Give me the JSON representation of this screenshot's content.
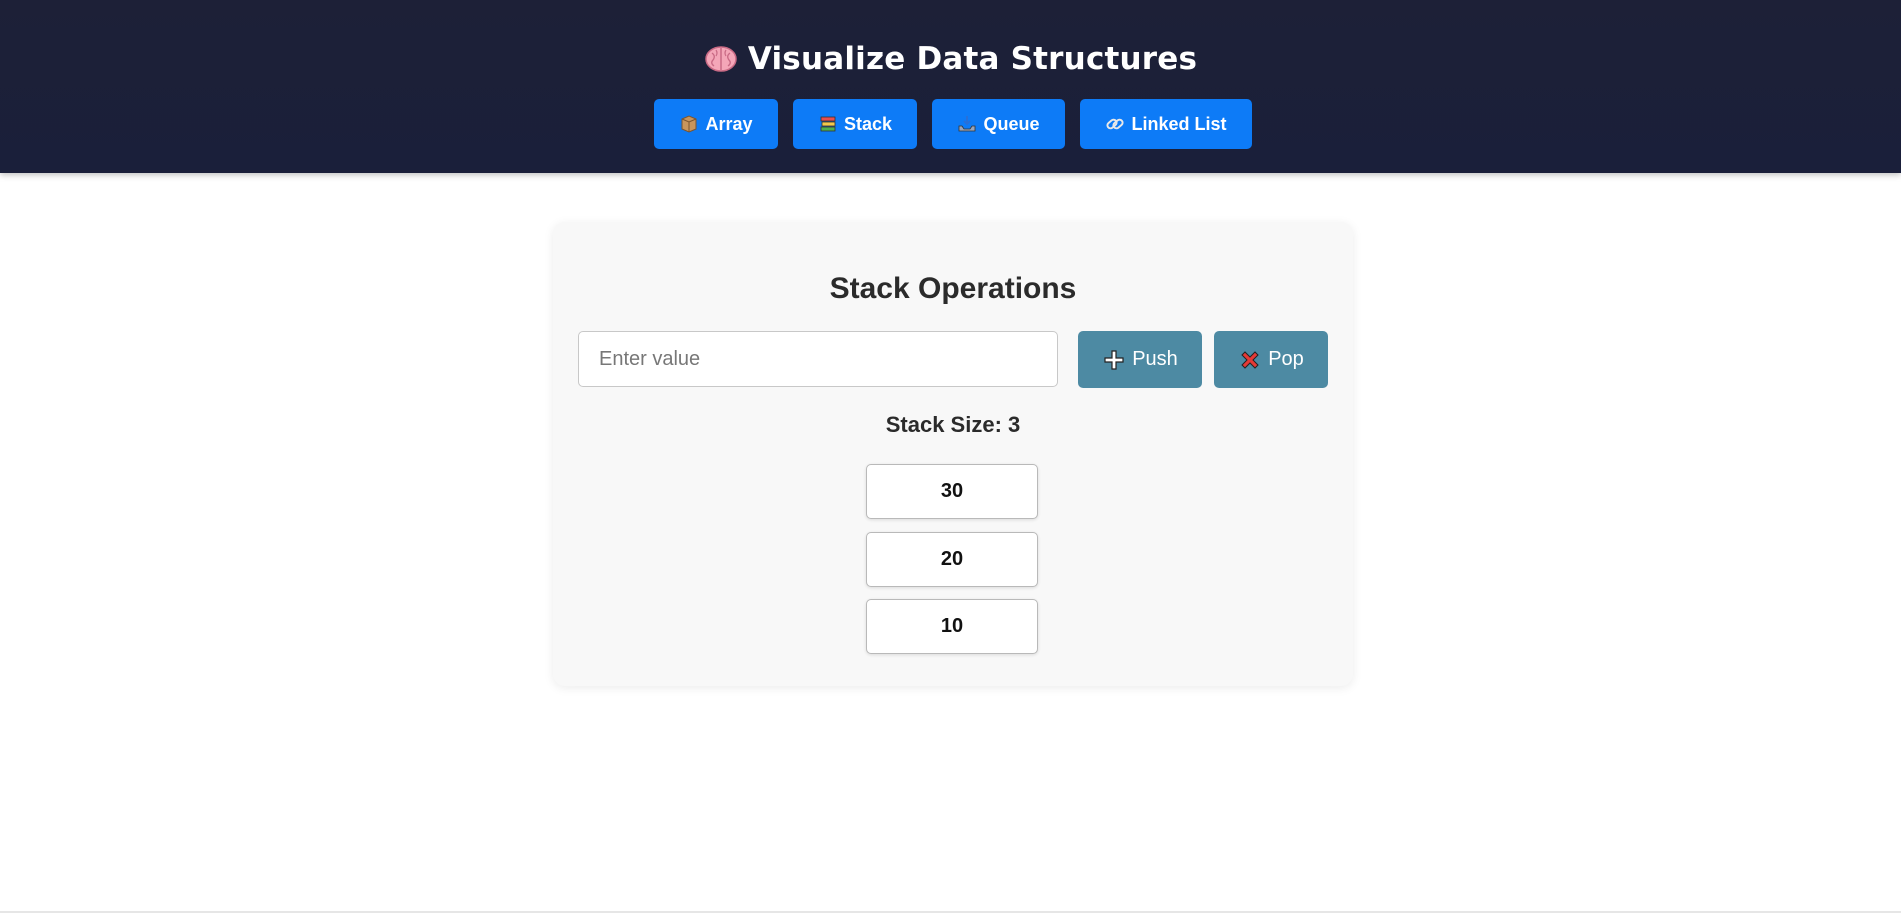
{
  "header": {
    "title": "Visualize Data Structures",
    "title_icon": "brain-icon"
  },
  "nav": [
    {
      "label": "Array",
      "icon": "box-icon"
    },
    {
      "label": "Stack",
      "icon": "books-icon"
    },
    {
      "label": "Queue",
      "icon": "inbox-tray-icon"
    },
    {
      "label": "Linked List",
      "icon": "link-icon"
    }
  ],
  "card": {
    "title": "Stack Operations",
    "input": {
      "placeholder": "Enter value",
      "value": ""
    },
    "push_label": "Push",
    "pop_label": "Pop",
    "size_text": "Stack Size: 3",
    "items": [
      "30",
      "20",
      "10"
    ]
  },
  "colors": {
    "header_bg": "#1a1f3a",
    "nav_button": "#0d7bf7",
    "op_button": "#4d8aa3",
    "card_bg": "#f8f8f8"
  }
}
